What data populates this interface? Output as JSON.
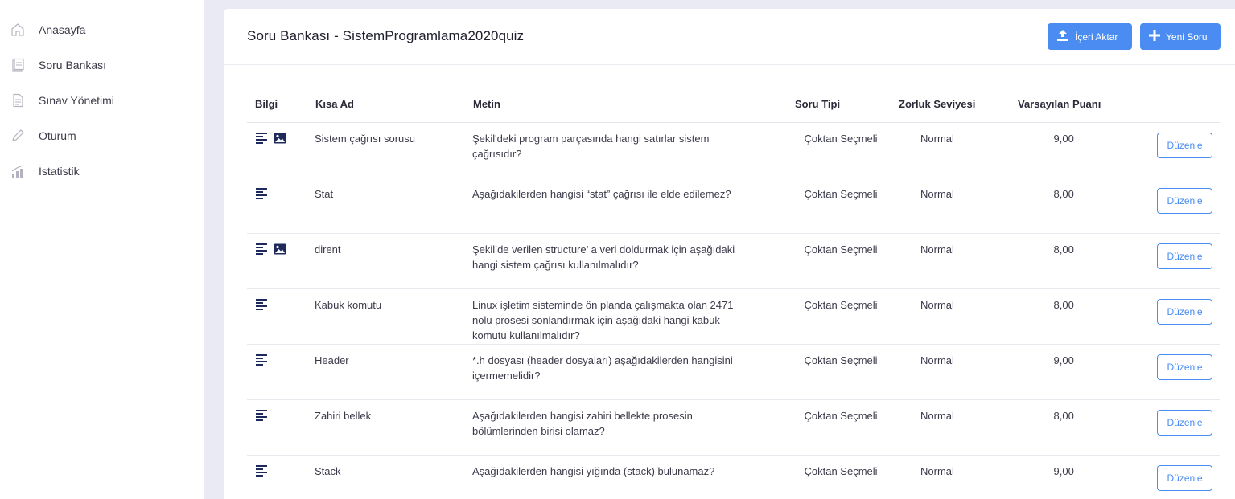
{
  "sidebar": {
    "items": [
      {
        "label": "Anasayfa",
        "icon": "home-icon"
      },
      {
        "label": "Soru Bankası",
        "icon": "question-bank-icon"
      },
      {
        "label": "Sınav Yönetimi",
        "icon": "document-icon"
      },
      {
        "label": "Oturum",
        "icon": "pencil-icon"
      },
      {
        "label": "İstatistik",
        "icon": "chart-icon"
      }
    ]
  },
  "header": {
    "title": "Soru Bankası - SistemProgramlama2020quiz",
    "import_label": "İçeri Aktar",
    "new_label": "Yeni Soru"
  },
  "table": {
    "columns": {
      "info": "Bilgi",
      "short_name": "Kısa Ad",
      "text": "Metin",
      "type": "Soru Tipi",
      "difficulty": "Zorluk Seviyesi",
      "score": "Varsayılan Puanı"
    },
    "edit_label": "Düzenle",
    "rows": [
      {
        "has_image": true,
        "short_name": "Sistem çağrısı sorusu",
        "text": "Şekil'deki program parçasında hangi satırlar sistem çağrısıdır?",
        "type": "Çoktan Seçmeli",
        "difficulty": "Normal",
        "score": "9,00"
      },
      {
        "has_image": false,
        "short_name": "Stat",
        "text": "Aşağıdakilerden hangisi “stat” çağrısı ile elde edilemez?",
        "type": "Çoktan Seçmeli",
        "difficulty": "Normal",
        "score": "8,00"
      },
      {
        "has_image": true,
        "short_name": "dirent",
        "text": "Şekil’de verilen structure’ a veri doldurmak için aşağıdaki hangi sistem çağrısı kullanılmalıdır?",
        "type": "Çoktan Seçmeli",
        "difficulty": "Normal",
        "score": "8,00"
      },
      {
        "has_image": false,
        "short_name": "Kabuk komutu",
        "text": "Linux işletim sisteminde ön planda çalışmakta olan 2471 nolu prosesi sonlandırmak için aşağıdaki hangi kabuk komutu kullanılmalıdır?",
        "type": "Çoktan Seçmeli",
        "difficulty": "Normal",
        "score": "8,00"
      },
      {
        "has_image": false,
        "short_name": "Header",
        "text": "*.h dosyası (header dosyaları) aşağıdakilerden hangisini içermemelidir?",
        "type": "Çoktan Seçmeli",
        "difficulty": "Normal",
        "score": "9,00"
      },
      {
        "has_image": false,
        "short_name": "Zahiri bellek",
        "text": "Aşağıdakilerden hangisi zahiri bellekte prosesin bölümlerinden birisi olamaz?",
        "type": "Çoktan Seçmeli",
        "difficulty": "Normal",
        "score": "8,00"
      },
      {
        "has_image": false,
        "short_name": "Stack",
        "text": "Aşağıdakilerden hangisi yığında (stack) bulunamaz?",
        "type": "Çoktan Seçmeli",
        "difficulty": "Normal",
        "score": "9,00"
      }
    ]
  },
  "colors": {
    "accent": "#4a8cf2",
    "icon_dark": "#1f2a5c",
    "background": "#e9eaf3"
  }
}
